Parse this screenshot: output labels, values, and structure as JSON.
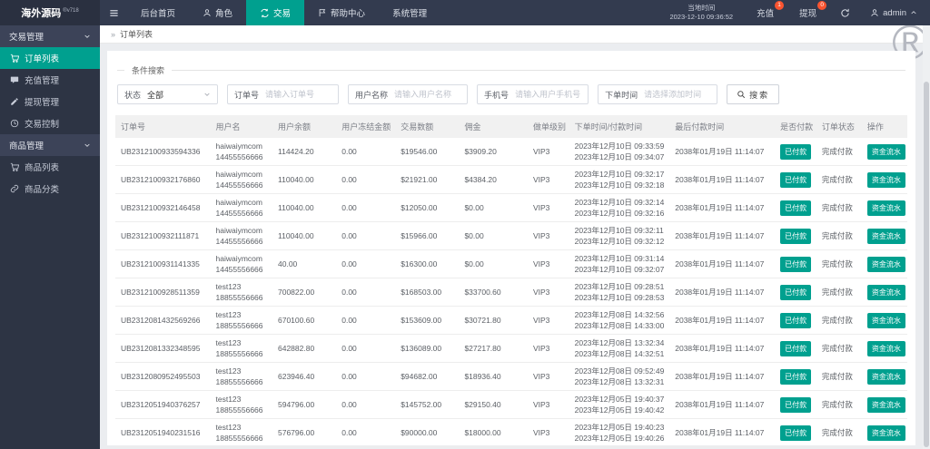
{
  "colors": {
    "accent": "#00a08f",
    "topbar_bg": "#333b4f",
    "logo_bg": "#2a3040",
    "sidebar_bg": "#2d3444",
    "group_bg": "#3c4358",
    "badge": "#fa5430"
  },
  "topbar": {
    "logo": "海外源码",
    "logo_badge": "®v718",
    "menu": [
      {
        "label": "后台首页"
      },
      {
        "label": "角色"
      },
      {
        "label": "交易"
      },
      {
        "label": "帮助中心"
      },
      {
        "label": "系统管理"
      }
    ],
    "clock_label": "当地时间",
    "clock_value": "2023-12-10 09:36:52",
    "recharge_label": "充值",
    "recharge_badge": "1",
    "withdraw_label": "提现",
    "withdraw_badge": "0",
    "username": "admin"
  },
  "sidebar": {
    "groups": [
      {
        "label": "交易管理",
        "items": [
          {
            "label": "订单列表"
          },
          {
            "label": "充值管理"
          },
          {
            "label": "提现管理"
          },
          {
            "label": "交易控制"
          }
        ]
      },
      {
        "label": "商品管理",
        "items": [
          {
            "label": "商品列表"
          },
          {
            "label": "商品分类"
          }
        ]
      }
    ]
  },
  "breadcrumb": {
    "separator": "»",
    "label": "订单列表"
  },
  "watermark": "®",
  "search": {
    "legend": "条件搜索",
    "status": {
      "label": "状态",
      "value": "全部"
    },
    "order_no": {
      "label": "订单号",
      "placeholder": "请输入订单号"
    },
    "user_name": {
      "label": "用户名称",
      "placeholder": "请输入用户名称"
    },
    "phone": {
      "label": "手机号",
      "placeholder": "请输入用户手机号"
    },
    "order_time": {
      "label": "下单时间",
      "placeholder": "请选择添加时间"
    },
    "search_button": "搜索"
  },
  "table": {
    "columns": [
      "订单号",
      "用户名",
      "用户余额",
      "用户冻结金额",
      "交易数额",
      "佣金",
      "做单级别",
      "下单时间/付款时间",
      "最后付款时间",
      "是否付款",
      "订单状态",
      "操作"
    ],
    "rows": [
      {
        "order_no": "UB2312100933594336",
        "user": "haiwaiymcom",
        "phone": "14455556666",
        "balance": "114424.20",
        "frozen": "0.00",
        "amount": "$19546.00",
        "commission": "$3909.20",
        "level": "VIP3",
        "order_time": "2023年12月10日 09:33:59",
        "pay_time": "2023年12月10日 09:34:07",
        "last_pay_time": "2038年01月19日 11:14:07",
        "paid": "已付款",
        "status": "完成付款",
        "action": "资金流水"
      },
      {
        "order_no": "UB2312100932176860",
        "user": "haiwaiymcom",
        "phone": "14455556666",
        "balance": "110040.00",
        "frozen": "0.00",
        "amount": "$21921.00",
        "commission": "$4384.20",
        "level": "VIP3",
        "order_time": "2023年12月10日 09:32:17",
        "pay_time": "2023年12月10日 09:32:18",
        "last_pay_time": "2038年01月19日 11:14:07",
        "paid": "已付款",
        "status": "完成付款",
        "action": "资金流水"
      },
      {
        "order_no": "UB2312100932146458",
        "user": "haiwaiymcom",
        "phone": "14455556666",
        "balance": "110040.00",
        "frozen": "0.00",
        "amount": "$12050.00",
        "commission": "$0.00",
        "level": "VIP3",
        "order_time": "2023年12月10日 09:32:14",
        "pay_time": "2023年12月10日 09:32:16",
        "last_pay_time": "2038年01月19日 11:14:07",
        "paid": "已付款",
        "status": "完成付款",
        "action": "资金流水"
      },
      {
        "order_no": "UB2312100932111871",
        "user": "haiwaiymcom",
        "phone": "14455556666",
        "balance": "110040.00",
        "frozen": "0.00",
        "amount": "$15966.00",
        "commission": "$0.00",
        "level": "VIP3",
        "order_time": "2023年12月10日 09:32:11",
        "pay_time": "2023年12月10日 09:32:12",
        "last_pay_time": "2038年01月19日 11:14:07",
        "paid": "已付款",
        "status": "完成付款",
        "action": "资金流水"
      },
      {
        "order_no": "UB2312100931141335",
        "user": "haiwaiymcom",
        "phone": "14455556666",
        "balance": "40.00",
        "frozen": "0.00",
        "amount": "$16300.00",
        "commission": "$0.00",
        "level": "VIP3",
        "order_time": "2023年12月10日 09:31:14",
        "pay_time": "2023年12月10日 09:32:07",
        "last_pay_time": "2038年01月19日 11:14:07",
        "paid": "已付款",
        "status": "完成付款",
        "action": "资金流水"
      },
      {
        "order_no": "UB2312100928511359",
        "user": "test123",
        "phone": "18855556666",
        "balance": "700822.00",
        "frozen": "0.00",
        "amount": "$168503.00",
        "commission": "$33700.60",
        "level": "VIP3",
        "order_time": "2023年12月10日 09:28:51",
        "pay_time": "2023年12月10日 09:28:53",
        "last_pay_time": "2038年01月19日 11:14:07",
        "paid": "已付款",
        "status": "完成付款",
        "action": "资金流水"
      },
      {
        "order_no": "UB2312081432569266",
        "user": "test123",
        "phone": "18855556666",
        "balance": "670100.60",
        "frozen": "0.00",
        "amount": "$153609.00",
        "commission": "$30721.80",
        "level": "VIP3",
        "order_time": "2023年12月08日 14:32:56",
        "pay_time": "2023年12月08日 14:33:00",
        "last_pay_time": "2038年01月19日 11:14:07",
        "paid": "已付款",
        "status": "完成付款",
        "action": "资金流水"
      },
      {
        "order_no": "UB2312081332348595",
        "user": "test123",
        "phone": "18855556666",
        "balance": "642882.80",
        "frozen": "0.00",
        "amount": "$136089.00",
        "commission": "$27217.80",
        "level": "VIP3",
        "order_time": "2023年12月08日 13:32:34",
        "pay_time": "2023年12月08日 14:32:51",
        "last_pay_time": "2038年01月19日 11:14:07",
        "paid": "已付款",
        "status": "完成付款",
        "action": "资金流水"
      },
      {
        "order_no": "UB2312080952495503",
        "user": "test123",
        "phone": "18855556666",
        "balance": "623946.40",
        "frozen": "0.00",
        "amount": "$94682.00",
        "commission": "$18936.40",
        "level": "VIP3",
        "order_time": "2023年12月08日 09:52:49",
        "pay_time": "2023年12月08日 13:32:31",
        "last_pay_time": "2038年01月19日 11:14:07",
        "paid": "已付款",
        "status": "完成付款",
        "action": "资金流水"
      },
      {
        "order_no": "UB2312051940376257",
        "user": "test123",
        "phone": "18855556666",
        "balance": "594796.00",
        "frozen": "0.00",
        "amount": "$145752.00",
        "commission": "$29150.40",
        "level": "VIP3",
        "order_time": "2023年12月05日 19:40:37",
        "pay_time": "2023年12月05日 19:40:42",
        "last_pay_time": "2038年01月19日 11:14:07",
        "paid": "已付款",
        "status": "完成付款",
        "action": "资金流水"
      },
      {
        "order_no": "UB2312051940231516",
        "user": "test123",
        "phone": "18855556666",
        "balance": "576796.00",
        "frozen": "0.00",
        "amount": "$90000.00",
        "commission": "$18000.00",
        "level": "VIP3",
        "order_time": "2023年12月05日 19:40:23",
        "pay_time": "2023年12月05日 19:40:26",
        "last_pay_time": "2038年01月19日 11:14:07",
        "paid": "已付款",
        "status": "完成付款",
        "action": "资金流水"
      }
    ]
  }
}
